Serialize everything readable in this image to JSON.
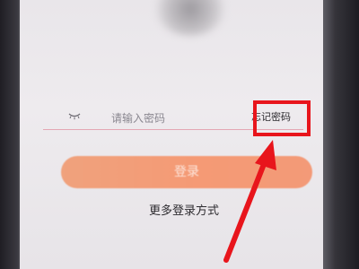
{
  "password_field": {
    "placeholder": "请输入密码",
    "value": ""
  },
  "forgot_password_label": "忘记密码",
  "login_button_label": "登录",
  "more_login_methods_label": "更多登录方式",
  "icons": {
    "password_visibility": "eye-closed-icon"
  },
  "colors": {
    "login_button": "#F59A75",
    "highlight_annotation": "#E8151C",
    "field_underline": "#E4A7B4"
  }
}
